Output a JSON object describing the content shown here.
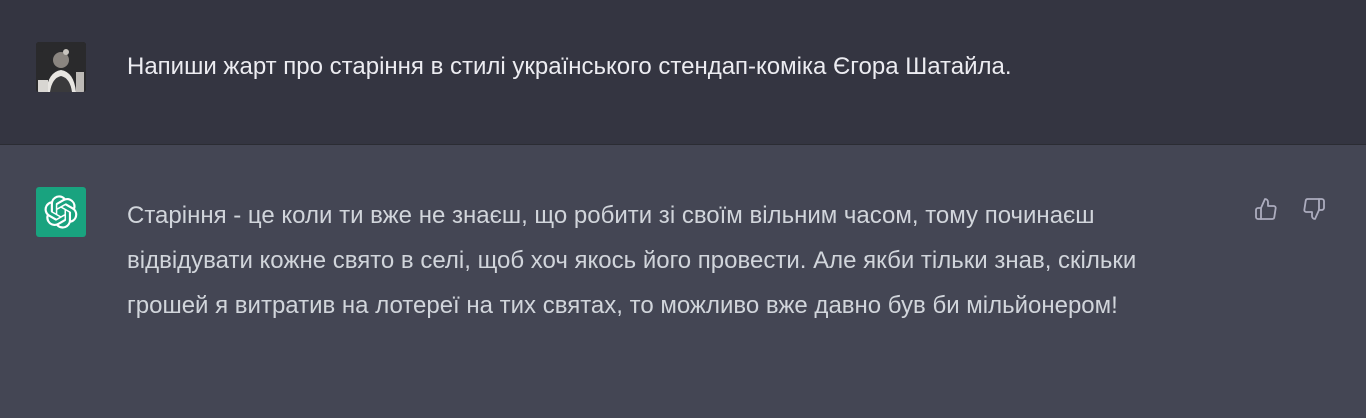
{
  "conversation": {
    "user_message": "Напиши жарт про старіння в стилі українського стендап-коміка Єгора Шатайла.",
    "assistant_message": "Старіння - це коли ти вже не знаєш, що робити зі своїм вільним часом, тому починаєш відвідувати кожне свято в селі, щоб хоч якось його провести. Але якби тільки знав, скільки грошей я витратив на лотереї на тих святах, то можливо вже давно був би мільйонером!"
  },
  "icons": {
    "user_avatar": "user-avatar-photo",
    "assistant_avatar": "openai-logo-icon",
    "feedback_up": "thumbs-up-icon",
    "feedback_down": "thumbs-down-icon"
  },
  "colors": {
    "user_row_bg": "#343541",
    "assistant_row_bg": "#444654",
    "assistant_avatar_bg": "#19a37f",
    "user_text": "#ececf1",
    "assistant_text": "#d1d5db",
    "icon": "#acacbe"
  }
}
